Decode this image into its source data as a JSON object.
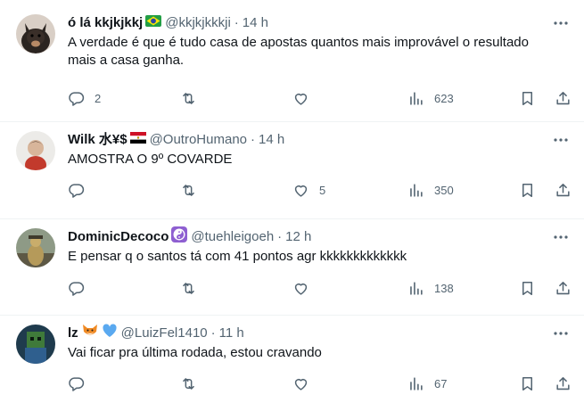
{
  "tweets": [
    {
      "name": "ó lá kkjkjkkj",
      "emoji": "flag-brazil",
      "handle": "@kkjkjkkkji",
      "time": "14 h",
      "text": "A verdade é que é tudo casa de apostas quantos mais improvável o resultado mais a casa ganha.",
      "replies": "2",
      "retweets": "",
      "likes": "",
      "views": "623"
    },
    {
      "name": "Wilk 水¥$",
      "emoji": "flag-egypt",
      "handle": "@OutroHumano",
      "time": "14 h",
      "text": "AMOSTRA O 9º COVARDE",
      "replies": "",
      "retweets": "",
      "likes": "5",
      "views": "350"
    },
    {
      "name": "DominicDecoco",
      "emoji": "yin-yang",
      "handle": "@tuehleigoeh",
      "time": "12 h",
      "text": "E pensar q o santos tá com 41 pontos agr kkkkkkkkkkkkk",
      "replies": "",
      "retweets": "",
      "likes": "",
      "views": "138"
    },
    {
      "name": "lz",
      "emoji": "fox-and-blue-heart",
      "handle": "@LuizFel1410",
      "time": "11 h",
      "text": "Vai ficar pra última rodada, estou cravando",
      "replies": "",
      "retweets": "",
      "likes": "",
      "views": "67"
    }
  ],
  "separator": "·",
  "colors": {
    "text": "#0f1419",
    "secondary": "#536471",
    "divider": "#eff3f4"
  }
}
